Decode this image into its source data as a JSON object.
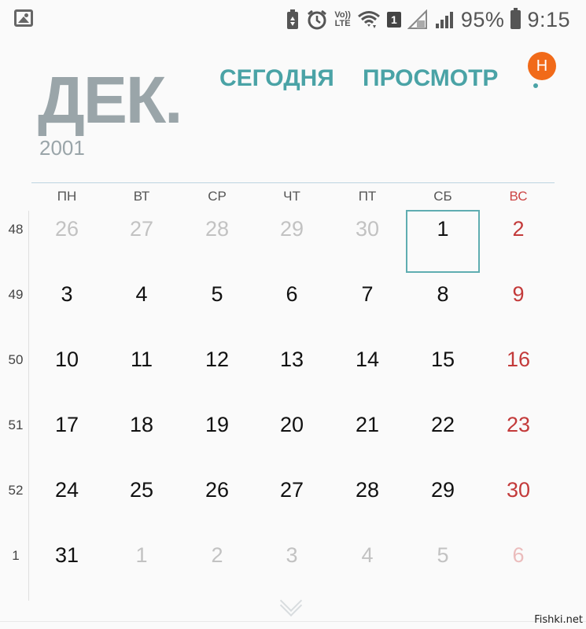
{
  "status_bar": {
    "battery_percent": "95%",
    "time": "9:15",
    "volte_line1": "Vo))",
    "volte_line2": "LTE",
    "sim_slot": "1",
    "icons": [
      "gallery-icon",
      "battery-saver-icon",
      "alarm-icon",
      "volte-icon",
      "wifi-icon",
      "sim-icon",
      "signal-icon",
      "signal-icon",
      "battery-icon"
    ]
  },
  "header": {
    "month": "ДЕК.",
    "year": "2001",
    "today_button": "СЕГОДНЯ",
    "view_button": "ПРОСМОТР",
    "badge_letter": "Н"
  },
  "weekdays": [
    "ПН",
    "ВТ",
    "СР",
    "ЧТ",
    "ПТ",
    "СБ",
    "ВС"
  ],
  "weeks": [
    {
      "number": "48",
      "days": [
        {
          "label": "26",
          "other_month": true
        },
        {
          "label": "27",
          "other_month": true
        },
        {
          "label": "28",
          "other_month": true
        },
        {
          "label": "29",
          "other_month": true
        },
        {
          "label": "30",
          "other_month": true
        },
        {
          "label": "1",
          "selected": true
        },
        {
          "label": "2"
        }
      ]
    },
    {
      "number": "49",
      "days": [
        {
          "label": "3"
        },
        {
          "label": "4"
        },
        {
          "label": "5"
        },
        {
          "label": "6"
        },
        {
          "label": "7"
        },
        {
          "label": "8"
        },
        {
          "label": "9"
        }
      ]
    },
    {
      "number": "50",
      "days": [
        {
          "label": "10"
        },
        {
          "label": "11"
        },
        {
          "label": "12"
        },
        {
          "label": "13"
        },
        {
          "label": "14"
        },
        {
          "label": "15"
        },
        {
          "label": "16"
        }
      ]
    },
    {
      "number": "51",
      "days": [
        {
          "label": "17"
        },
        {
          "label": "18"
        },
        {
          "label": "19"
        },
        {
          "label": "20"
        },
        {
          "label": "21"
        },
        {
          "label": "22"
        },
        {
          "label": "23"
        }
      ]
    },
    {
      "number": "52",
      "days": [
        {
          "label": "24"
        },
        {
          "label": "25"
        },
        {
          "label": "26"
        },
        {
          "label": "27"
        },
        {
          "label": "28"
        },
        {
          "label": "29"
        },
        {
          "label": "30"
        }
      ]
    },
    {
      "number": "1",
      "days": [
        {
          "label": "31"
        },
        {
          "label": "1",
          "other_month": true
        },
        {
          "label": "2",
          "other_month": true
        },
        {
          "label": "3",
          "other_month": true
        },
        {
          "label": "4",
          "other_month": true
        },
        {
          "label": "5",
          "other_month": true
        },
        {
          "label": "6",
          "other_month": true
        }
      ]
    }
  ],
  "colors": {
    "accent": "#4aa3a6",
    "sunday": "#c33a3a",
    "badge": "#f16a19",
    "month_title": "#9aa5a9"
  },
  "watermark": "Fishki.net"
}
